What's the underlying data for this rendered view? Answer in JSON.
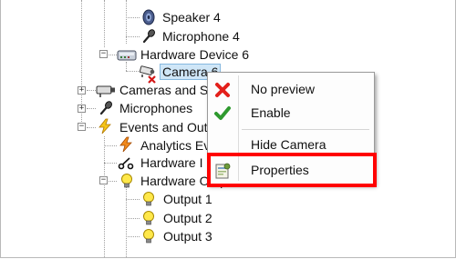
{
  "tree": {
    "items": [
      {
        "label": "Speaker 4",
        "icon": "speaker-icon"
      },
      {
        "label": "Microphone 4",
        "icon": "microphone-icon"
      },
      {
        "label": "Hardware Device 6",
        "icon": "hardware-device-icon"
      },
      {
        "label": "Camera 6",
        "icon": "camera-disabled-icon"
      },
      {
        "label": "Cameras and St",
        "icon": "camera-icon"
      },
      {
        "label": "Microphones",
        "icon": "microphone-icon"
      },
      {
        "label": "Events and Out",
        "icon": "events-icon"
      },
      {
        "label": "Analytics Ev",
        "icon": "analytics-event-icon"
      },
      {
        "label": "Hardware I",
        "icon": "hardware-input-icon"
      },
      {
        "label": "Hardware Output",
        "icon": "lightbulb-icon"
      },
      {
        "label": "Output 1",
        "icon": "lightbulb-icon"
      },
      {
        "label": "Output 2",
        "icon": "lightbulb-icon"
      },
      {
        "label": "Output 3",
        "icon": "lightbulb-icon"
      }
    ]
  },
  "context_menu": {
    "items": [
      {
        "label": "No preview",
        "icon": "red-x-icon"
      },
      {
        "label": "Enable",
        "icon": "green-check-icon"
      },
      {
        "label": "Hide Camera",
        "icon": ""
      },
      {
        "label": "Properties",
        "icon": "properties-icon"
      }
    ],
    "highlight_color": "#ff0000"
  }
}
